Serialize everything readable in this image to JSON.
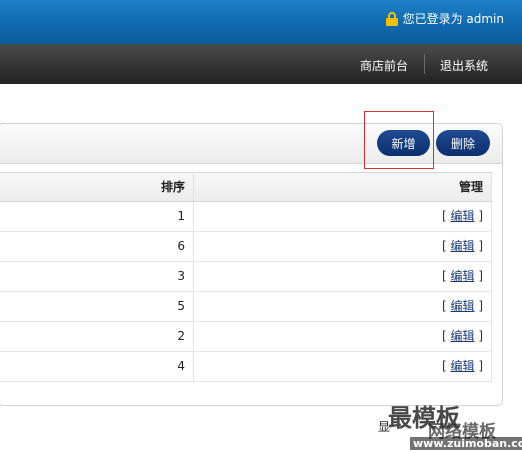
{
  "header": {
    "login_text": "您已登录为 admin"
  },
  "nav": {
    "front": "商店前台",
    "logout": "退出系统"
  },
  "toolbar": {
    "add_label": "新增",
    "delete_label": "删除"
  },
  "table": {
    "columns": [
      "排序",
      "管理"
    ],
    "rows": [
      {
        "sort": "1",
        "action": "编辑"
      },
      {
        "sort": "6",
        "action": "编辑"
      },
      {
        "sort": "3",
        "action": "编辑"
      },
      {
        "sort": "5",
        "action": "编辑"
      },
      {
        "sort": "2",
        "action": "编辑"
      },
      {
        "sort": "4",
        "action": "编辑"
      }
    ]
  },
  "footer": {
    "text": "显"
  },
  "watermark": {
    "title": "最模板",
    "subtitle": "网络模板",
    "url": "www.zuimoban.com"
  },
  "colors": {
    "topbar": "#1272b8",
    "navbar": "#2b2b2b",
    "button": "#153d80",
    "highlight": "#d9302c"
  },
  "icons": {
    "lock": "lock-icon"
  }
}
